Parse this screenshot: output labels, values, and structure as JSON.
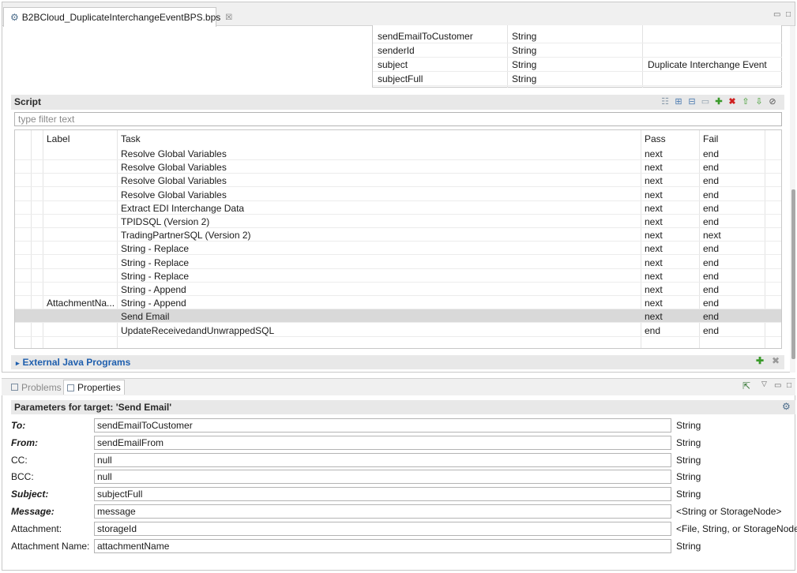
{
  "editor": {
    "tab_title": "B2BCloud_DuplicateInterchangeEventBPS.bps",
    "tab_close": "☒",
    "minimize": "▭",
    "maximize": "□"
  },
  "variables": [
    {
      "name": "sendEmailToCustomer",
      "type": "String",
      "value": ""
    },
    {
      "name": "senderId",
      "type": "String",
      "value": ""
    },
    {
      "name": "subject",
      "type": "String",
      "value": "Duplicate Interchange Event"
    },
    {
      "name": "subjectFull",
      "type": "String",
      "value": ""
    }
  ],
  "script": {
    "title": "Script",
    "filter_placeholder": "type filter text",
    "columns": {
      "label": "Label",
      "task": "Task",
      "pass": "Pass",
      "fail": "Fail"
    },
    "rows": [
      {
        "label": "",
        "task": "Resolve Global Variables",
        "pass": "next",
        "fail": "end"
      },
      {
        "label": "",
        "task": "Resolve Global Variables",
        "pass": "next",
        "fail": "end"
      },
      {
        "label": "",
        "task": "Resolve Global Variables",
        "pass": "next",
        "fail": "end"
      },
      {
        "label": "",
        "task": "Resolve Global Variables",
        "pass": "next",
        "fail": "end"
      },
      {
        "label": "",
        "task": "Extract EDI Interchange Data",
        "pass": "next",
        "fail": "end"
      },
      {
        "label": "",
        "task": "TPIDSQL (Version 2)",
        "pass": "next",
        "fail": "end"
      },
      {
        "label": "",
        "task": "TradingPartnerSQL (Version 2)",
        "pass": "next",
        "fail": "next"
      },
      {
        "label": "",
        "task": "String - Replace",
        "pass": "next",
        "fail": "end"
      },
      {
        "label": "",
        "task": "String - Replace",
        "pass": "next",
        "fail": "end"
      },
      {
        "label": "",
        "task": "String - Replace",
        "pass": "next",
        "fail": "end"
      },
      {
        "label": "",
        "task": "String - Append",
        "pass": "next",
        "fail": "end"
      },
      {
        "label": "AttachmentNa...",
        "task": "String - Append",
        "pass": "next",
        "fail": "end"
      },
      {
        "label": "",
        "task": "Send Email",
        "pass": "next",
        "fail": "end"
      },
      {
        "label": "",
        "task": "UpdateReceivedandUnwrappedSQL",
        "pass": "end",
        "fail": "end"
      }
    ]
  },
  "external_java": {
    "label": "External Java Programs"
  },
  "panel": {
    "problems_tab": "Problems",
    "properties_tab": "Properties",
    "params_title": "Parameters for target: 'Send Email'"
  },
  "params": [
    {
      "label": "To:",
      "value": "sendEmailToCustomer",
      "type": "String",
      "required": true
    },
    {
      "label": "From:",
      "value": "sendEmailFrom",
      "type": "String",
      "required": true
    },
    {
      "label": "CC:",
      "value": "null",
      "type": "String",
      "required": false
    },
    {
      "label": "BCC:",
      "value": "null",
      "type": "String",
      "required": false
    },
    {
      "label": "Subject:",
      "value": "subjectFull",
      "type": "String",
      "required": true
    },
    {
      "label": "Message:",
      "value": "message",
      "type": "<String or StorageNode>",
      "required": true
    },
    {
      "label": "Attachment:",
      "value": "storageId",
      "type": "<File, String, or StorageNode>",
      "required": false
    },
    {
      "label": "Attachment Name:",
      "value": "attachmentName",
      "type": "String",
      "required": false
    }
  ]
}
